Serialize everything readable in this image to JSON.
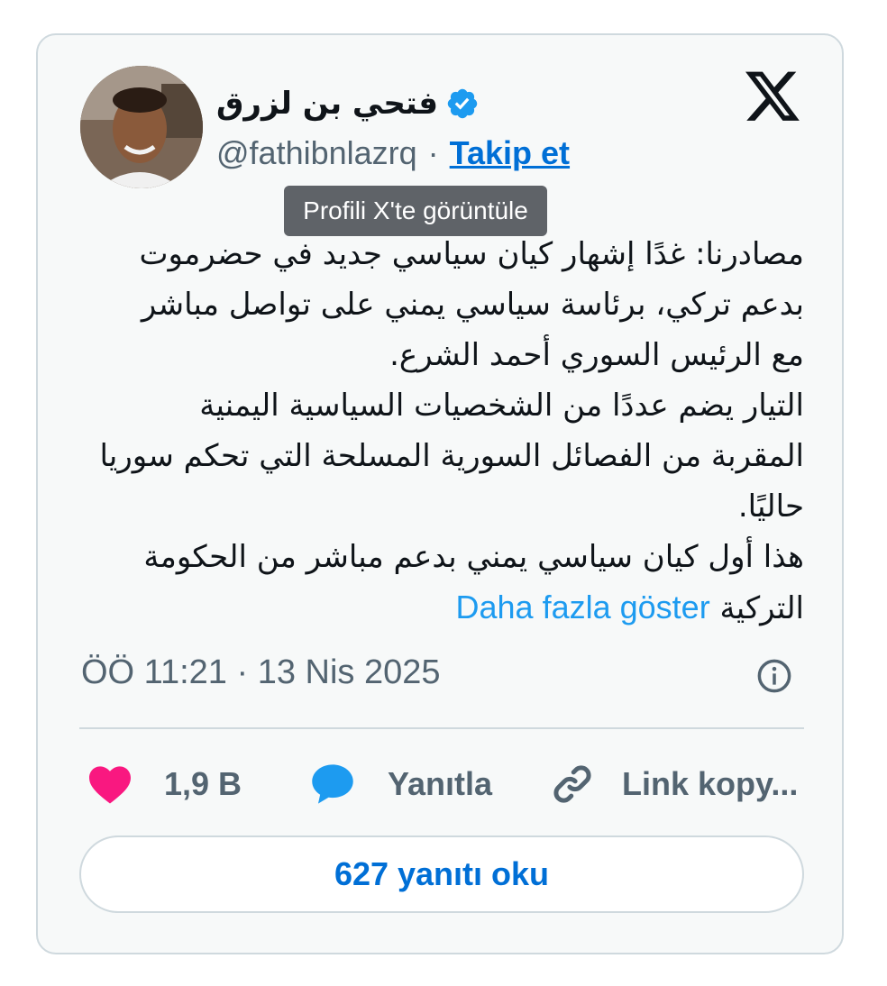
{
  "user": {
    "name": "فتحي بن لزرق",
    "handle": "@fathibnlazrq",
    "separator": "·",
    "follow_label": "Takip et",
    "verified_color": "#1d9bf0"
  },
  "tooltip": "Profili X'te görüntüle",
  "tweet": {
    "lines": [
      "مصادرنا: غدًا إشهار كيان سياسي جديد في حضرموت",
      "بدعم تركي، برئاسة سياسي يمني على تواصل مباشر",
      "مع الرئيس السوري أحمد الشرع.",
      "التيار يضم عددًا من الشخصيات السياسية اليمنية",
      "المقربة من الفصائل السورية المسلحة التي تحكم سوريا",
      "حاليًا.",
      "هذا أول كيان سياسي يمني بدعم مباشر من الحكومة"
    ],
    "last_line": "التركية",
    "show_more": "Daha fazla göster"
  },
  "timestamp": "ÖÖ 11:21 · 13 Nis 2025",
  "actions": {
    "like_count": "1,9 B",
    "reply_label": "Yanıtla",
    "copy_link_label": "Link kopy..."
  },
  "read_replies": "627 yanıtı oku",
  "colors": {
    "like": "#f91880",
    "reply": "#1d9bf0",
    "link": "#006fd6"
  },
  "icons": [
    "verified-badge-icon",
    "x-logo-icon",
    "info-icon",
    "heart-icon",
    "speech-bubble-icon",
    "link-icon"
  ]
}
